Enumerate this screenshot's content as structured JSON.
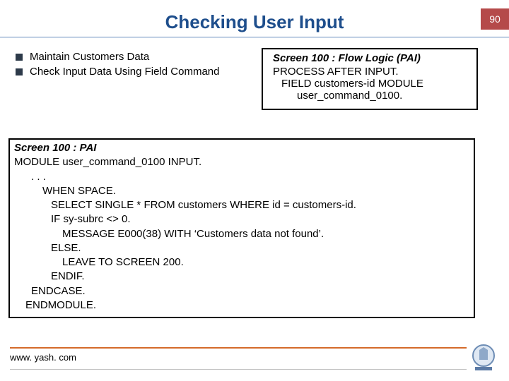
{
  "page_number": "90",
  "title": "Checking User Input",
  "bullets": {
    "b0": "Maintain Customers Data",
    "b1_pre": "Check Input Data Using ",
    "b1_field": "Field",
    "b1_post": " Command"
  },
  "flow": {
    "title": "Screen 100 : Flow Logic (PAI)",
    "l1": "PROCESS AFTER INPUT.",
    "l2": "FIELD customers-id MODULE",
    "l3": "user_command_0100."
  },
  "pai": {
    "title": "Screen 100 : PAI",
    "l0": "MODULE user_command_0100 INPUT.",
    "l1": ". . .",
    "l2": "WHEN SPACE.",
    "l3": "SELECT SINGLE * FROM customers WHERE id = customers-id.",
    "l4": "IF sy-subrc <> 0.",
    "l5": "MESSAGE E000(38) WITH ‘Customers data not found’.",
    "l6": "ELSE.",
    "l7": "LEAVE TO SCREEN 200.",
    "l8": "ENDIF.",
    "l9": "ENDCASE.",
    "l10": "ENDMODULE."
  },
  "footer_url": "www. yash. com"
}
